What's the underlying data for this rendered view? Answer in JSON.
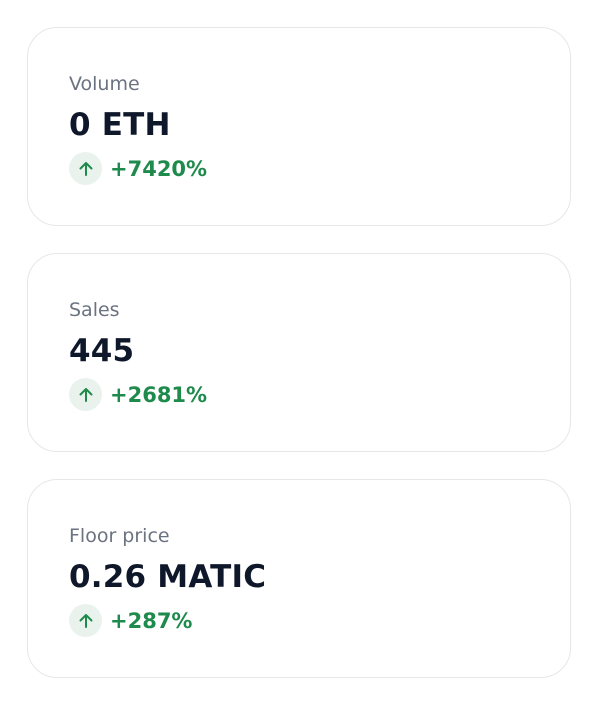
{
  "stats": [
    {
      "label": "Volume",
      "value": "0 ETH",
      "change": "+7420%",
      "trend_icon": "arrow-up-icon"
    },
    {
      "label": "Sales",
      "value": "445",
      "change": "+2681%",
      "trend_icon": "arrow-up-icon"
    },
    {
      "label": "Floor price",
      "value": "0.26 MATIC",
      "change": "+287%",
      "trend_icon": "arrow-up-icon"
    }
  ],
  "colors": {
    "positive": "#1e8a4c",
    "positive_bg": "#e9f2ec",
    "label": "#6b7280",
    "value": "#0f172a",
    "card_border": "#e5e7eb"
  }
}
